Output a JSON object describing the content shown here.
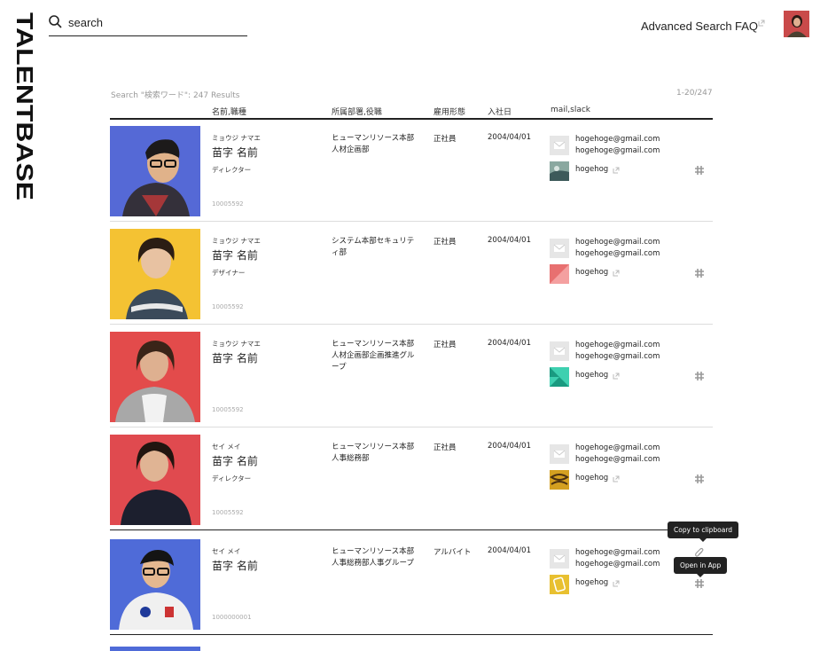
{
  "brand": {
    "logo_text": "TALENTBASE"
  },
  "search": {
    "placeholder": "search"
  },
  "header": {
    "advanced_search": "Advanced Search",
    "faq": "FAQ"
  },
  "results": {
    "summary": "Search \"検索ワード\": 247 Results",
    "range": "1-20/247",
    "columns": {
      "name_role": "名前,職種",
      "dept": "所属部署,役職",
      "employment": "雇用形態",
      "joined": "入社日",
      "contact": "mail,slack"
    },
    "rows": [
      {
        "kana": "ミョウジ ナマエ",
        "name": "苗字 名前",
        "role": "ディレクター",
        "id": "10005592",
        "dept": "ヒューマンリソース本部 人材企画部",
        "employment": "正社員",
        "joined": "2004/04/01",
        "mail1": "hogehoge@gmail.com",
        "mail2": "hogehoge@gmail.com",
        "slack": "hogehog"
      },
      {
        "kana": "ミョウジ ナマエ",
        "name": "苗字 名前",
        "role": "デザイナー",
        "id": "10005592",
        "dept": "システム本部セキュリティ部",
        "employment": "正社員",
        "joined": "2004/04/01",
        "mail1": "hogehoge@gmail.com",
        "mail2": "hogehoge@gmail.com",
        "slack": "hogehog"
      },
      {
        "kana": "ミョウジ ナマエ",
        "name": "苗字 名前",
        "role": "",
        "id": "10005592",
        "dept": "ヒューマンリソース本部 人材企画部企画推進グループ",
        "employment": "正社員",
        "joined": "2004/04/01",
        "mail1": "hogehoge@gmail.com",
        "mail2": "hogehoge@gmail.com",
        "slack": "hogehog"
      },
      {
        "kana": "セイ メイ",
        "name": "苗字 名前",
        "role": "ディレクター",
        "id": "10005592",
        "dept": "ヒューマンリソース本部 人事総務部",
        "employment": "正社員",
        "joined": "2004/04/01",
        "mail1": "hogehoge@gmail.com",
        "mail2": "hogehoge@gmail.com",
        "slack": "hogehog"
      },
      {
        "kana": "セイ メイ",
        "name": "苗字 名前",
        "role": "",
        "id": "1000000001",
        "dept": "ヒューマンリソース本部 人事総務部人事グループ",
        "employment": "アルバイト",
        "joined": "2004/04/01",
        "mail1": "hogehoge@gmail.com",
        "mail2": "hogehoge@gmail.com",
        "slack": "hogehog"
      }
    ]
  },
  "tooltips": {
    "copy": "Copy to clipboard",
    "open_app": "Open in App"
  },
  "colors": {
    "row1_bg": "#5569d6",
    "row2_bg": "#f4c233",
    "row3_bg": "#e34b4b",
    "row4_bg": "#e04a4f",
    "row5_bg": "#4f6bd8",
    "accent_red": "#c94a4a"
  }
}
